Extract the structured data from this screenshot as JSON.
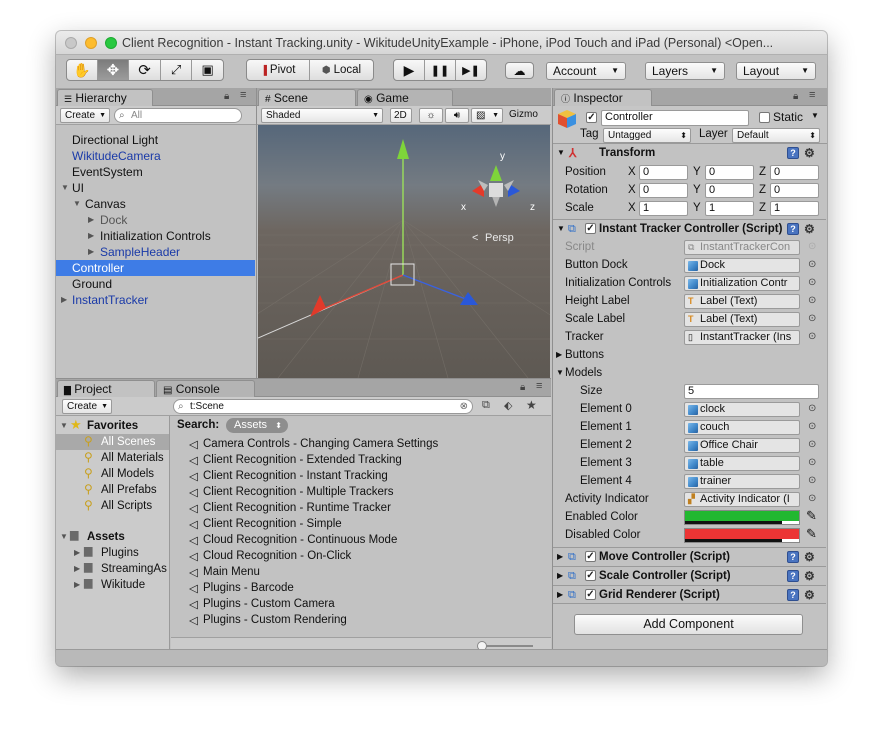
{
  "window": {
    "title": "Client Recognition - Instant Tracking.unity - WikitudeUnityExample - iPhone, iPod Touch and iPad (Personal) <Open..."
  },
  "toolbar": {
    "tools": [
      "hand-tool",
      "move-tool",
      "rotate-tool",
      "scale-tool",
      "rect-tool"
    ],
    "pivot_label": "Pivot",
    "local_label": "Local",
    "play_label": "▶",
    "pause_label": "❚❚",
    "step_label": "▶❚",
    "account_label": "Account",
    "layers_label": "Layers",
    "layout_label": "Layout"
  },
  "hierarchy": {
    "tab_label": "Hierarchy",
    "create_label": "Create",
    "search_placeholder": "All",
    "items": [
      {
        "label": "Directional Light"
      },
      {
        "label": "WikitudeCamera"
      },
      {
        "label": "EventSystem"
      },
      {
        "label": "UI"
      },
      {
        "label": "Canvas"
      },
      {
        "label": "Dock"
      },
      {
        "label": "Initialization Controls"
      },
      {
        "label": "SampleHeader"
      },
      {
        "label": "Controller"
      },
      {
        "label": "Ground"
      },
      {
        "label": "InstantTracker"
      }
    ]
  },
  "scene": {
    "tab_scene": "Scene",
    "tab_game": "Game",
    "shading_mode": "Shaded",
    "mode_2d": "2D",
    "gizmos_label": "Gizmo",
    "persp_label": "Persp",
    "axis_y": "y",
    "axis_x": "x",
    "axis_z": "z"
  },
  "project": {
    "tab_project": "Project",
    "tab_console": "Console",
    "create_label": "Create",
    "search_value": "t:Scene",
    "search_label": "Search:",
    "assets_chip": "Assets",
    "favorites_label": "Favorites",
    "favorites": [
      "All Scenes",
      "All Materials",
      "All Models",
      "All Prefabs",
      "All Scripts"
    ],
    "assets_label": "Assets",
    "asset_folders": [
      "Plugins",
      "StreamingAs",
      "Wikitude"
    ],
    "scenes": [
      "Camera Controls - Changing Camera Settings",
      "Client Recognition - Extended Tracking",
      "Client Recognition - Instant Tracking",
      "Client Recognition - Multiple Trackers",
      "Client Recognition - Runtime Tracker",
      "Client Recognition - Simple",
      "Cloud Recognition - Continuous Mode",
      "Cloud Recognition - On-Click",
      "Main Menu",
      "Plugins - Barcode",
      "Plugins - Custom Camera",
      "Plugins - Custom Rendering"
    ]
  },
  "inspector": {
    "tab_label": "Inspector",
    "object_name": "Controller",
    "static_label": "Static",
    "tag_label": "Tag",
    "tag_value": "Untagged",
    "layer_label": "Layer",
    "layer_value": "Default",
    "transform": {
      "title": "Transform",
      "position": {
        "label": "Position",
        "x": "0",
        "y": "0",
        "z": "0"
      },
      "rotation": {
        "label": "Rotation",
        "x": "0",
        "y": "0",
        "z": "0"
      },
      "scale": {
        "label": "Scale",
        "x": "1",
        "y": "1",
        "z": "1"
      }
    },
    "tracker_controller": {
      "title": "Instant Tracker Controller (Script)",
      "fields": [
        {
          "label": "Script",
          "value": "InstantTrackerCon"
        },
        {
          "label": "Button Dock",
          "value": "Dock"
        },
        {
          "label": "Initialization Controls",
          "value": "Initialization Contr"
        },
        {
          "label": "Height Label",
          "value": "Label (Text)"
        },
        {
          "label": "Scale Label",
          "value": "Label (Text)"
        },
        {
          "label": "Tracker",
          "value": "InstantTracker (Ins"
        }
      ],
      "buttons_label": "Buttons",
      "models_label": "Models",
      "size_label": "Size",
      "size_value": "5",
      "elements": [
        {
          "label": "Element 0",
          "value": "clock"
        },
        {
          "label": "Element 1",
          "value": "couch"
        },
        {
          "label": "Element 2",
          "value": "Office Chair"
        },
        {
          "label": "Element 3",
          "value": "table"
        },
        {
          "label": "Element 4",
          "value": "trainer"
        }
      ],
      "activity_label": "Activity Indicator",
      "activity_value": "Activity Indicator (I",
      "enabled_color_label": "Enabled Color",
      "enabled_color": "#22b830",
      "disabled_color_label": "Disabled Color",
      "disabled_color": "#ec3434"
    },
    "components": [
      {
        "title": "Move Controller (Script)"
      },
      {
        "title": "Scale Controller (Script)"
      },
      {
        "title": "Grid Renderer (Script)"
      }
    ],
    "add_component_label": "Add Component"
  },
  "colors": {
    "selection": "#3e7ce6",
    "traffic_close": "#fc5f57",
    "traffic_min": "#fdbc2e",
    "traffic_max": "#28c840"
  }
}
